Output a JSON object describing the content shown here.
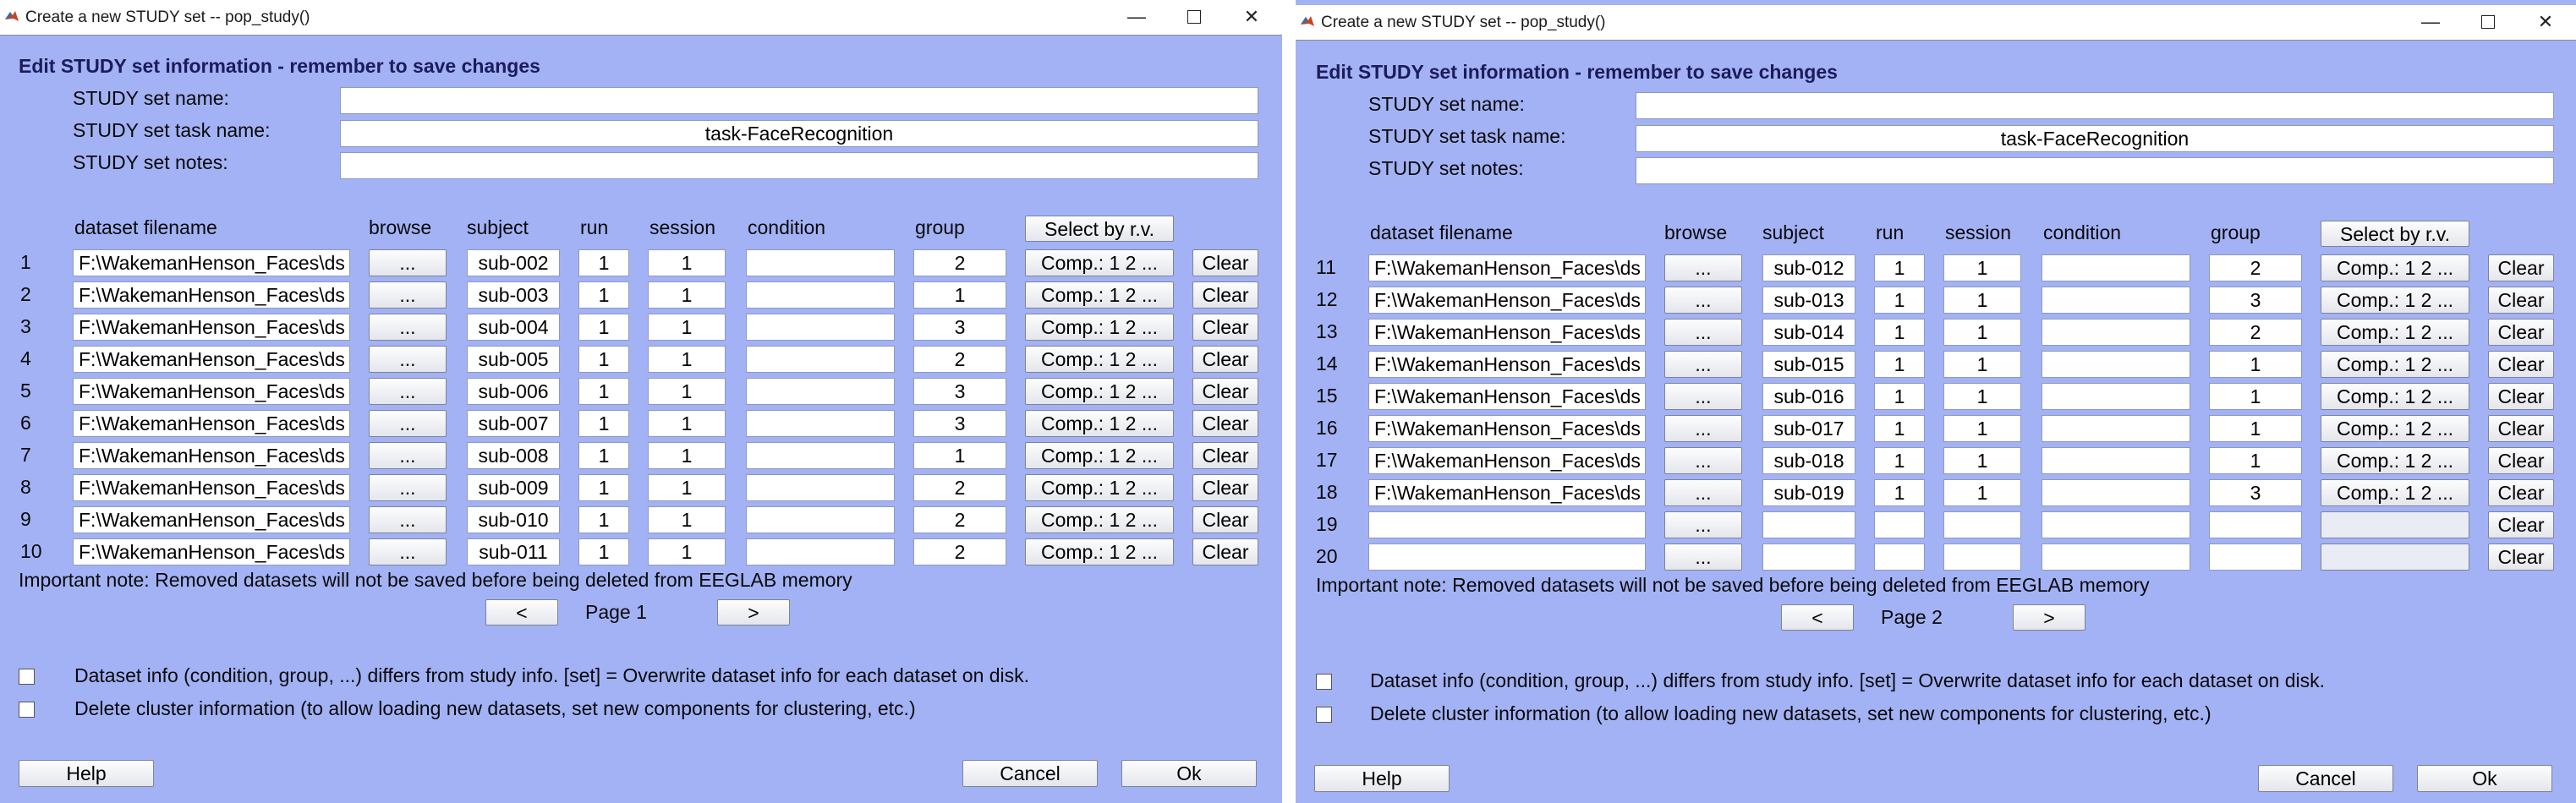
{
  "windows": [
    {
      "title": "Create a new STUDY set -- pop_study()",
      "heading": "Edit STUDY set information - remember to save changes",
      "study_name_label": "STUDY set name:",
      "study_name_value": "",
      "task_label": "STUDY set task name:",
      "task_value": "task-FaceRecognition",
      "notes_label": "STUDY set notes:",
      "notes_value": "",
      "headers": {
        "filename": "dataset filename",
        "browse": "browse",
        "subject": "subject",
        "run": "run",
        "session": "session",
        "condition": "condition",
        "group": "group",
        "select_rv": "Select by r.v."
      },
      "rows": [
        {
          "num": "1",
          "filename": "F:\\WakemanHenson_Faces\\ds",
          "browse": "...",
          "subject": "sub-002",
          "run": "1",
          "session": "1",
          "condition": "",
          "group": "2",
          "comp": "Comp.: 1  2 ...",
          "clear": "Clear"
        },
        {
          "num": "2",
          "filename": "F:\\WakemanHenson_Faces\\ds",
          "browse": "...",
          "subject": "sub-003",
          "run": "1",
          "session": "1",
          "condition": "",
          "group": "1",
          "comp": "Comp.: 1  2 ...",
          "clear": "Clear"
        },
        {
          "num": "3",
          "filename": "F:\\WakemanHenson_Faces\\ds",
          "browse": "...",
          "subject": "sub-004",
          "run": "1",
          "session": "1",
          "condition": "",
          "group": "3",
          "comp": "Comp.: 1  2 ...",
          "clear": "Clear"
        },
        {
          "num": "4",
          "filename": "F:\\WakemanHenson_Faces\\ds",
          "browse": "...",
          "subject": "sub-005",
          "run": "1",
          "session": "1",
          "condition": "",
          "group": "2",
          "comp": "Comp.: 1  2 ...",
          "clear": "Clear"
        },
        {
          "num": "5",
          "filename": "F:\\WakemanHenson_Faces\\ds",
          "browse": "...",
          "subject": "sub-006",
          "run": "1",
          "session": "1",
          "condition": "",
          "group": "3",
          "comp": "Comp.: 1  2 ...",
          "clear": "Clear"
        },
        {
          "num": "6",
          "filename": "F:\\WakemanHenson_Faces\\ds",
          "browse": "...",
          "subject": "sub-007",
          "run": "1",
          "session": "1",
          "condition": "",
          "group": "3",
          "comp": "Comp.: 1  2 ...",
          "clear": "Clear"
        },
        {
          "num": "7",
          "filename": "F:\\WakemanHenson_Faces\\ds",
          "browse": "...",
          "subject": "sub-008",
          "run": "1",
          "session": "1",
          "condition": "",
          "group": "1",
          "comp": "Comp.: 1  2 ...",
          "clear": "Clear"
        },
        {
          "num": "8",
          "filename": "F:\\WakemanHenson_Faces\\ds",
          "browse": "...",
          "subject": "sub-009",
          "run": "1",
          "session": "1",
          "condition": "",
          "group": "2",
          "comp": "Comp.: 1  2 ...",
          "clear": "Clear"
        },
        {
          "num": "9",
          "filename": "F:\\WakemanHenson_Faces\\ds",
          "browse": "...",
          "subject": "sub-010",
          "run": "1",
          "session": "1",
          "condition": "",
          "group": "2",
          "comp": "Comp.: 1  2 ...",
          "clear": "Clear"
        },
        {
          "num": "10",
          "filename": "F:\\WakemanHenson_Faces\\ds",
          "browse": "...",
          "subject": "sub-011",
          "run": "1",
          "session": "1",
          "condition": "",
          "group": "2",
          "comp": "Comp.: 1  2 ...",
          "clear": "Clear"
        }
      ],
      "note": "Important note: Removed datasets will not be saved before being deleted from EEGLAB memory",
      "prev": "<",
      "page_label": "Page 1",
      "next": ">",
      "checkbox1_label": "Dataset info (condition, group, ...) differs from study info. [set] = Overwrite dataset info for each dataset on disk.",
      "checkbox2_label": "Delete cluster information (to allow loading new datasets, set new components for clustering, etc.)",
      "help": "Help",
      "cancel": "Cancel",
      "ok": "Ok"
    },
    {
      "title": "Create a new STUDY set -- pop_study()",
      "heading": "Edit STUDY set information - remember to save changes",
      "study_name_label": "STUDY set name:",
      "study_name_value": "",
      "task_label": "STUDY set task name:",
      "task_value": "task-FaceRecognition",
      "notes_label": "STUDY set notes:",
      "notes_value": "",
      "headers": {
        "filename": "dataset filename",
        "browse": "browse",
        "subject": "subject",
        "run": "run",
        "session": "session",
        "condition": "condition",
        "group": "group",
        "select_rv": "Select by r.v."
      },
      "rows": [
        {
          "num": "11",
          "filename": "F:\\WakemanHenson_Faces\\ds",
          "browse": "...",
          "subject": "sub-012",
          "run": "1",
          "session": "1",
          "condition": "",
          "group": "2",
          "comp": "Comp.: 1  2 ...",
          "clear": "Clear"
        },
        {
          "num": "12",
          "filename": "F:\\WakemanHenson_Faces\\ds",
          "browse": "...",
          "subject": "sub-013",
          "run": "1",
          "session": "1",
          "condition": "",
          "group": "3",
          "comp": "Comp.: 1  2 ...",
          "clear": "Clear"
        },
        {
          "num": "13",
          "filename": "F:\\WakemanHenson_Faces\\ds",
          "browse": "...",
          "subject": "sub-014",
          "run": "1",
          "session": "1",
          "condition": "",
          "group": "2",
          "comp": "Comp.: 1  2 ...",
          "clear": "Clear"
        },
        {
          "num": "14",
          "filename": "F:\\WakemanHenson_Faces\\ds",
          "browse": "...",
          "subject": "sub-015",
          "run": "1",
          "session": "1",
          "condition": "",
          "group": "1",
          "comp": "Comp.: 1  2 ...",
          "clear": "Clear"
        },
        {
          "num": "15",
          "filename": "F:\\WakemanHenson_Faces\\ds",
          "browse": "...",
          "subject": "sub-016",
          "run": "1",
          "session": "1",
          "condition": "",
          "group": "1",
          "comp": "Comp.: 1  2 ...",
          "clear": "Clear"
        },
        {
          "num": "16",
          "filename": "F:\\WakemanHenson_Faces\\ds",
          "browse": "...",
          "subject": "sub-017",
          "run": "1",
          "session": "1",
          "condition": "",
          "group": "1",
          "comp": "Comp.: 1  2 ...",
          "clear": "Clear"
        },
        {
          "num": "17",
          "filename": "F:\\WakemanHenson_Faces\\ds",
          "browse": "...",
          "subject": "sub-018",
          "run": "1",
          "session": "1",
          "condition": "",
          "group": "1",
          "comp": "Comp.: 1  2 ...",
          "clear": "Clear"
        },
        {
          "num": "18",
          "filename": "F:\\WakemanHenson_Faces\\ds",
          "browse": "...",
          "subject": "sub-019",
          "run": "1",
          "session": "1",
          "condition": "",
          "group": "3",
          "comp": "Comp.: 1  2 ...",
          "clear": "Clear"
        },
        {
          "num": "19",
          "filename": "",
          "browse": "...",
          "subject": "",
          "run": "",
          "session": "",
          "condition": "",
          "group": "",
          "comp": "",
          "clear": "Clear"
        },
        {
          "num": "20",
          "filename": "",
          "browse": "...",
          "subject": "",
          "run": "",
          "session": "",
          "condition": "",
          "group": "",
          "comp": "",
          "clear": "Clear"
        }
      ],
      "note": "Important note: Removed datasets will not be saved before being deleted from EEGLAB memory",
      "prev": "<",
      "page_label": "Page 2",
      "next": ">",
      "checkbox1_label": "Dataset info (condition, group, ...) differs from study info. [set] = Overwrite dataset info for each dataset on disk.",
      "checkbox2_label": "Delete cluster information (to allow loading new datasets, set new components for clustering, etc.)",
      "help": "Help",
      "cancel": "Cancel",
      "ok": "Ok"
    }
  ],
  "colors": {
    "dialog_bg": "#a3b2f5",
    "heading": "#1c1c5a",
    "titlebar": "#ffffff",
    "app_icon": "#c8451c"
  }
}
